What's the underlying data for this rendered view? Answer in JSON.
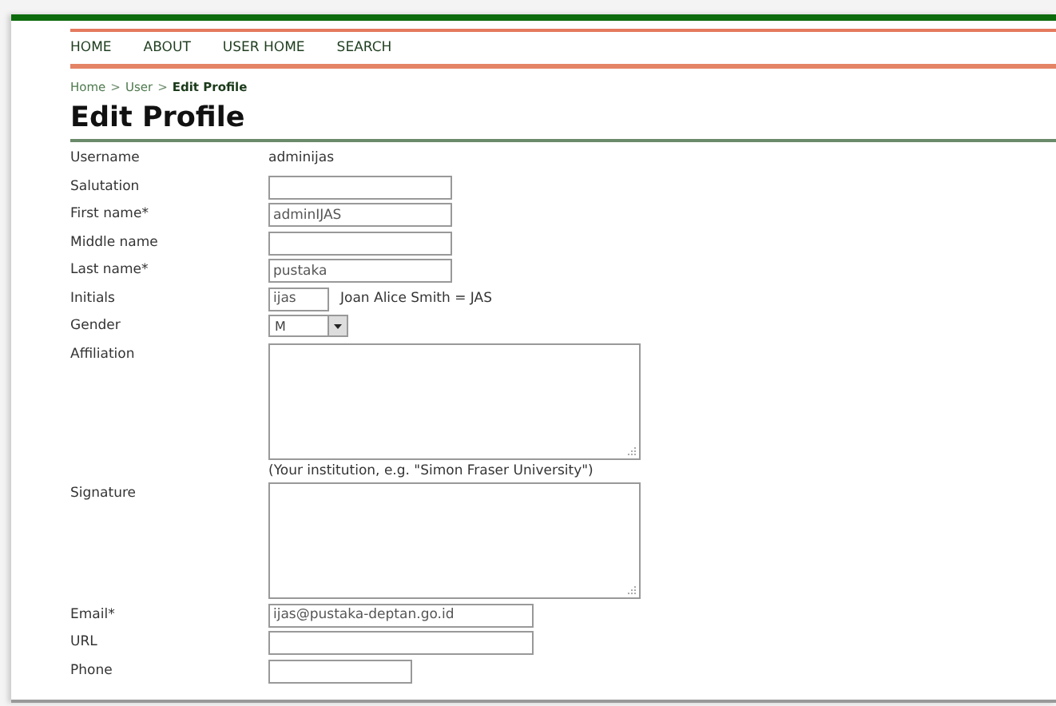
{
  "nav": [
    {
      "label": "HOME"
    },
    {
      "label": "ABOUT"
    },
    {
      "label": "USER HOME"
    },
    {
      "label": "SEARCH"
    }
  ],
  "breadcrumb": [
    {
      "label": "Home",
      "current": false
    },
    {
      "label": "User",
      "current": false
    },
    {
      "label": "Edit Profile",
      "current": true
    }
  ],
  "breadcrumb_separator": ">",
  "title": "Edit Profile",
  "fields": [
    {
      "kind": "static",
      "label": "Username",
      "value": "adminijas"
    },
    {
      "kind": "text",
      "label": "Salutation"
    },
    {
      "kind": "text",
      "label": "First name*",
      "value": "adminIJAS"
    },
    {
      "kind": "text",
      "label": "Middle name"
    },
    {
      "kind": "text",
      "label": "Last name*",
      "value": "pustaka"
    },
    {
      "kind": "short",
      "label": "Initials",
      "value": "ijas",
      "note": "Joan Alice Smith = JAS"
    },
    {
      "kind": "select",
      "label": "Gender",
      "value": "M"
    },
    {
      "kind": "textarea",
      "label": "Affiliation",
      "hint": "(Your institution, e.g. \"Simon Fraser University\")"
    },
    {
      "kind": "textarea",
      "label": "Signature"
    },
    {
      "kind": "wide",
      "label": "Email*",
      "value": "ijas@pustaka-deptan.go.id"
    },
    {
      "kind": "wide",
      "label": "URL"
    },
    {
      "kind": "narrow",
      "label": "Phone"
    }
  ]
}
